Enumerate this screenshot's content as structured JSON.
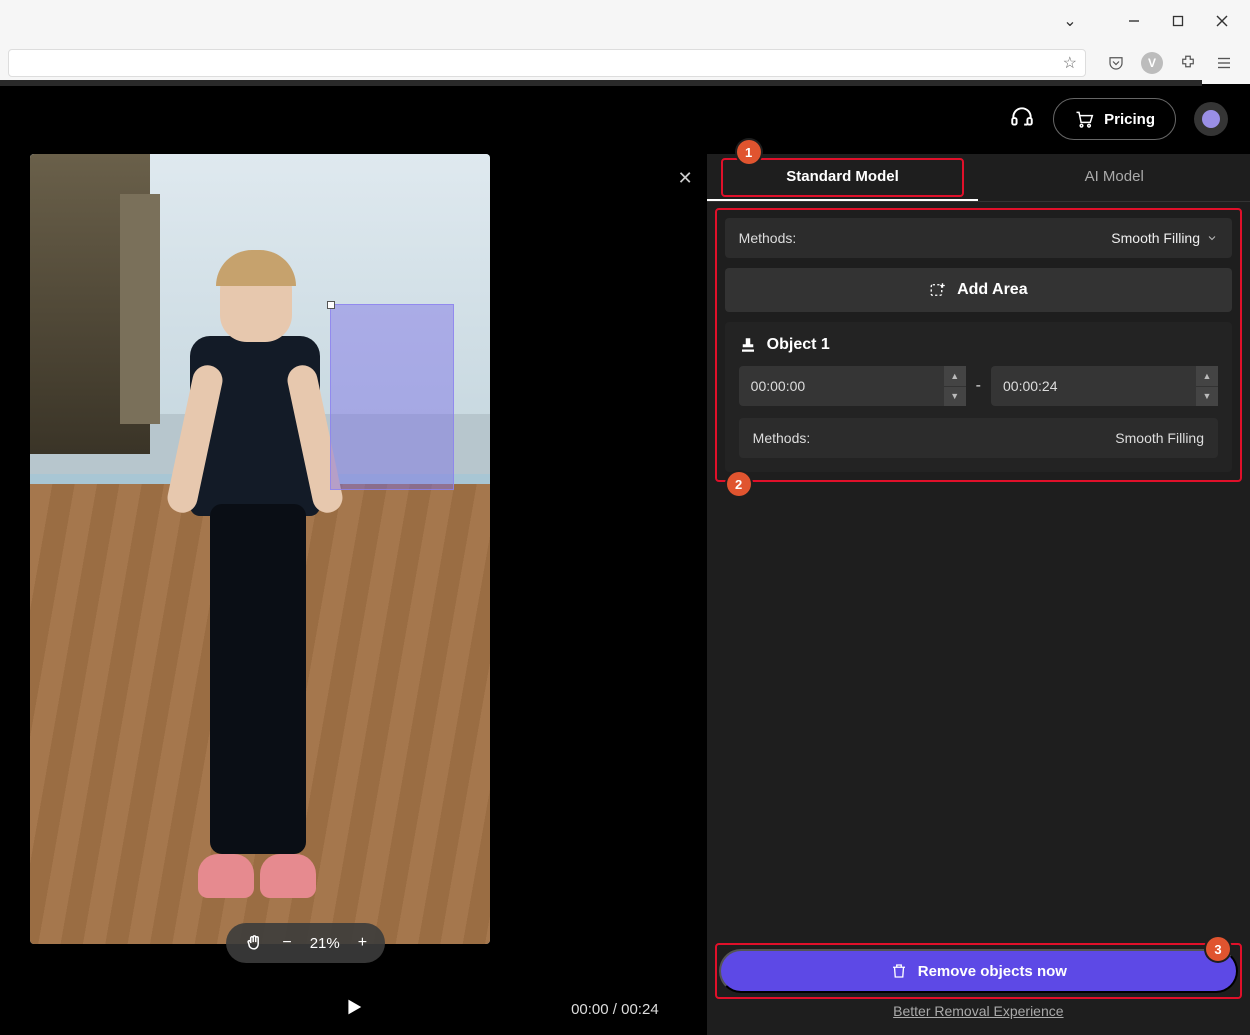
{
  "window": {
    "chevron": "⌄",
    "min": "—",
    "max": "▢",
    "close": "✕",
    "v_letter": "V"
  },
  "toolbar": {
    "star": "☆",
    "pocket": "⌵",
    "ext": "✦",
    "menu": "≣"
  },
  "header": {
    "pricing": "Pricing"
  },
  "canvas": {
    "zoom": "21%",
    "minus": "−",
    "plus": "+"
  },
  "playbar": {
    "current": "00:00",
    "sep": " / ",
    "total": "00:24"
  },
  "tabs": {
    "standard": "Standard Model",
    "ai": "AI Model"
  },
  "panel": {
    "methods_label": "Methods:",
    "methods_value": "Smooth Filling",
    "add_area": "Add Area",
    "object": {
      "name": "Object 1",
      "start": "00:00:00",
      "dash": "-",
      "end": "00:00:24",
      "methods_label": "Methods:",
      "methods_value": "Smooth Filling"
    }
  },
  "footer": {
    "remove_now": "Remove objects now",
    "better": "Better Removal Experience"
  },
  "callouts": {
    "one": "1",
    "two": "2",
    "three": "3"
  }
}
